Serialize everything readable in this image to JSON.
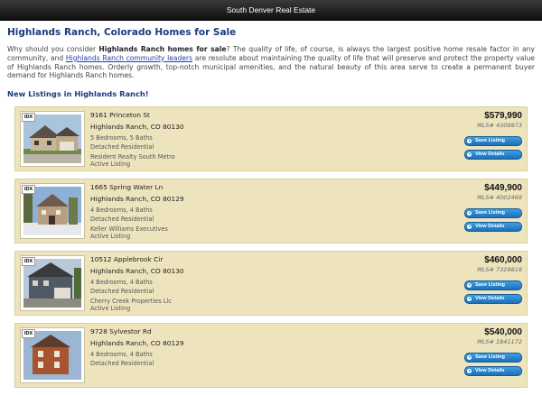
{
  "topbar": {
    "title": "South Denver Real Estate"
  },
  "page": {
    "title": "Highlands Ranch, Colorado Homes for Sale",
    "intro_pre": "Why should you consider ",
    "intro_bold": "Highlands Ranch homes for sale",
    "intro_mid": "? The quality of life, of course, is always the largest positive home resale factor in any community, and ",
    "intro_link": "Highlands Ranch community leaders",
    "intro_post": " are resolute about maintaining the quality of life that will preserve and protect the property value of Highlands Ranch homes. Orderly growth, top-notch municipal amenities, and the natural beauty of this area serve to create a permanent buyer demand for Highlands Ranch homes.",
    "section_heading": "New Listings in Highlands Ranch!"
  },
  "buttons": {
    "save": "Save Listing",
    "view": "View Details"
  },
  "icons": {
    "button_arrow": "play-arrow-icon"
  },
  "colors": {
    "accent": "#1a3a80",
    "button": "#2a86d0",
    "card": "#ede4bd"
  },
  "listings": [
    {
      "idx": "IDX",
      "street": "9161 Princeton St",
      "city": "Highlands Ranch, CO 80130",
      "beds": "5 Bedrooms, 5 Baths",
      "type": "Detached Residential",
      "agent": "Resident Realty South Metro",
      "status": "Active Listing",
      "price": "$579,990",
      "mls": "MLS# 4308873"
    },
    {
      "idx": "IDX",
      "street": "1665 Spring Water Ln",
      "city": "Highlands Ranch, CO 80129",
      "beds": "4 Bedrooms, 4 Baths",
      "type": "Detached Residential",
      "agent": "Keller Williams Executives",
      "status": "Active Listing",
      "price": "$449,900",
      "mls": "MLS# 4002469"
    },
    {
      "idx": "IDX",
      "street": "10512 Applebrook Cir",
      "city": "Highlands Ranch, CO 80130",
      "beds": "4 Bedrooms, 4 Baths",
      "type": "Detached Residential",
      "agent": "Cherry Creek Properties Llc",
      "status": "Active Listing",
      "price": "$460,000",
      "mls": "MLS# 7329818"
    },
    {
      "idx": "IDX",
      "street": "9728 Sylvestor Rd",
      "city": "Highlands Ranch, CO 80129",
      "beds": "4 Bedrooms, 4 Baths",
      "type": "Detached Residential",
      "agent": "",
      "status": "",
      "price": "$540,000",
      "mls": "MLS# 1841172"
    }
  ]
}
